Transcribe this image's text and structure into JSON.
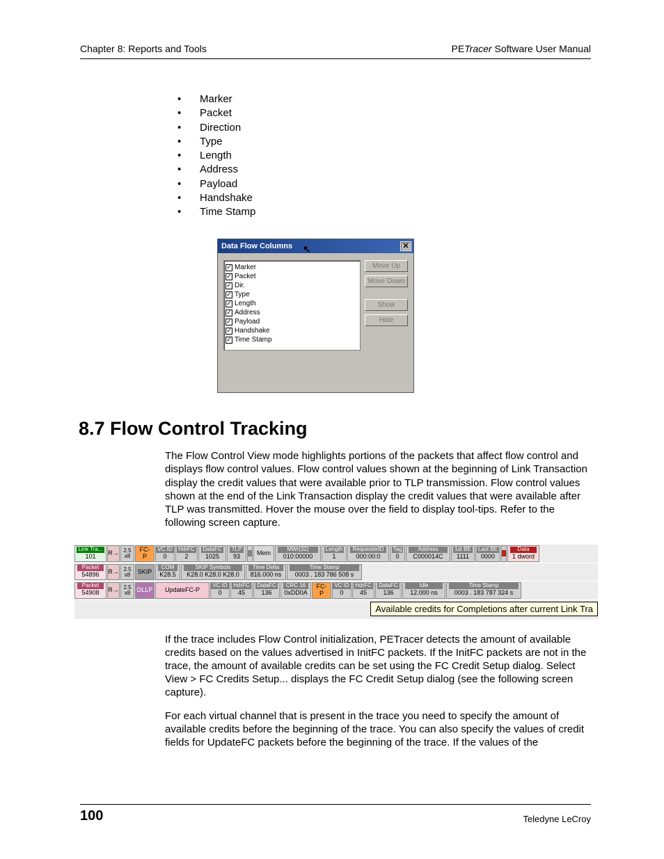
{
  "header": {
    "left": "Chapter 8: Reports and Tools",
    "right_prefix": "PE",
    "right_italic": "Tracer",
    "right_suffix": " Software User Manual"
  },
  "bullets": [
    "Marker",
    "Packet",
    "Direction",
    "Type",
    "Length",
    "Address",
    "Payload",
    "Handshake",
    "Time Stamp"
  ],
  "dialog": {
    "title": "Data Flow Columns",
    "items": [
      "Marker",
      "Packet",
      "Dir.",
      "Type",
      "Length",
      "Address",
      "Payload",
      "Handshake",
      "Time Stamp"
    ],
    "buttons": {
      "up": "Move Up",
      "down": "Move Down",
      "show": "Show",
      "hide": "Hide"
    }
  },
  "section_heading": "8.7 Flow Control Tracking",
  "para1": "The Flow Control View mode highlights portions of the packets that affect flow control and displays flow control values. Flow control values shown at the beginning of Link Transaction display the credit values that were available prior to TLP transmission. Flow control values shown at the end of the Link Transaction display the credit values that were available after TLP was transmitted. Hover the mouse over the field to display tool-tips. Refer to the following screen capture.",
  "trace": {
    "row1": {
      "link": {
        "hdr": "Link Tra...",
        "val": "101"
      },
      "r": "R→",
      "lane": {
        "top": "2.5",
        "bot": "x8"
      },
      "fcp": "FC-P",
      "vcid": {
        "hdr": "VC ID",
        "val": "0"
      },
      "hdrfc": {
        "hdr": "HdrFC",
        "val": "2"
      },
      "datafc": {
        "hdr": "DataFC",
        "val": "1025"
      },
      "tlp": {
        "hdr": "TLP",
        "val": "93"
      },
      "dot": ".",
      "mem": "Mem",
      "mwr": {
        "hdr": "MWr(32)",
        "val": "010:00000"
      },
      "length": {
        "hdr": "Length",
        "val": "1"
      },
      "req": {
        "hdr": "RequesterID",
        "val": "000:00:0"
      },
      "tag": {
        "hdr": "Tag",
        "val": "0"
      },
      "addr": {
        "hdr": "Address",
        "val": "C000014C"
      },
      "be1": {
        "hdr": "1st BE",
        "val": "1111"
      },
      "be2": {
        "hdr": "Last BE",
        "val": "0000"
      },
      "data": {
        "hdr": "Data",
        "val": "1 dword",
        "dot": "."
      }
    },
    "row2": {
      "pkt": {
        "hdr": "Packet",
        "val": "54896"
      },
      "r": "R→",
      "lane": {
        "top": "2.5",
        "bot": "x8"
      },
      "skip": "SKIP",
      "com": {
        "hdr": "COM",
        "val": "K28.5"
      },
      "sym": {
        "hdr": "SKIP Symbols",
        "val": "K28.0 K28.0 K28.0"
      },
      "td": {
        "hdr": "Time Delta",
        "val": "816.000 ns"
      },
      "ts": {
        "hdr": "Time Stamp",
        "val": "0003 . 183 786 508 s"
      }
    },
    "row3": {
      "pkt": {
        "hdr": "Packet",
        "val": "54908"
      },
      "r": "R→",
      "lane": {
        "top": "2.5",
        "bot": "x8"
      },
      "dllp": "DLLP",
      "upd": "UpdateFC-P",
      "vcid": {
        "hdr": "VC ID",
        "val": "0"
      },
      "hdrfc": {
        "hdr": "HdrFC",
        "val": "45"
      },
      "datafc": {
        "hdr": "DataFC",
        "val": "136"
      },
      "crc": {
        "hdr": "CRC 16",
        "val": "0xDD0A"
      },
      "fcp": "FC-P",
      "vcid2": {
        "hdr": "VC ID",
        "val": "0"
      },
      "hdrfc2": {
        "hdr": "HdrFC",
        "val": "45"
      },
      "datafc2": {
        "hdr": "DataFC",
        "val": "136"
      },
      "idle": {
        "hdr": "Idle",
        "val": "12.000 ns"
      },
      "ts": {
        "hdr": "Time Stamp",
        "val": "0003 . 183 787 324 s"
      }
    },
    "tooltip": "Available credits for Completions after current Link Tra"
  },
  "para2": "If the trace includes Flow Control initialization, PETracer detects the amount of available credits based on the values advertised in InitFC packets. If the InitFC packets are not in the trace, the amount of available credits can be set using the FC Credit Setup dialog. Select View > FC Credits Setup... displays the FC Credit Setup dialog (see the following screen capture).",
  "para3": "For each virtual channel that is present in the trace you need to specify the amount of available credits before the beginning of the trace. You can also specify the values of credit fields for UpdateFC packets before the beginning of the trace. If the values of the",
  "footer": {
    "page": "100",
    "brand": "Teledyne LeCroy"
  }
}
